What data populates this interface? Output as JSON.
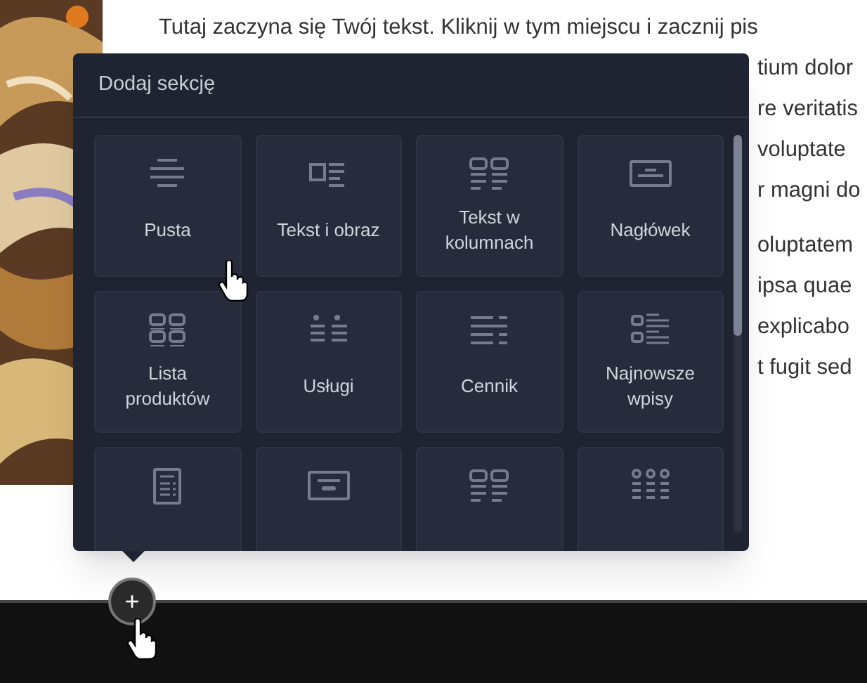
{
  "text": {
    "first_line": "Tutaj zaczyna się Twój tekst. Kliknij w tym miejscu i zacznij pis",
    "paragraphs": [
      [
        "tium dolor",
        "re veritatis",
        "voluptate",
        "r magni do"
      ],
      [
        "oluptatem",
        "ipsa quae",
        "explicabo",
        "t fugit sed"
      ]
    ]
  },
  "panel": {
    "title": "Dodaj sekcję",
    "tiles": [
      {
        "kind": "blank",
        "label": "Pusta"
      },
      {
        "kind": "text-image",
        "label": "Tekst i obraz"
      },
      {
        "kind": "text-columns",
        "label": "Tekst w kolumnach"
      },
      {
        "kind": "heading",
        "label": "Nagłówek"
      },
      {
        "kind": "products",
        "label": "Lista produktów"
      },
      {
        "kind": "services",
        "label": "Usługi"
      },
      {
        "kind": "pricing",
        "label": "Cennik"
      },
      {
        "kind": "posts",
        "label": "Najnowsze wpisy"
      },
      {
        "kind": "form"
      },
      {
        "kind": "banner"
      },
      {
        "kind": "two-columns"
      },
      {
        "kind": "three-columns"
      }
    ]
  },
  "add_button": {
    "label": "+"
  }
}
